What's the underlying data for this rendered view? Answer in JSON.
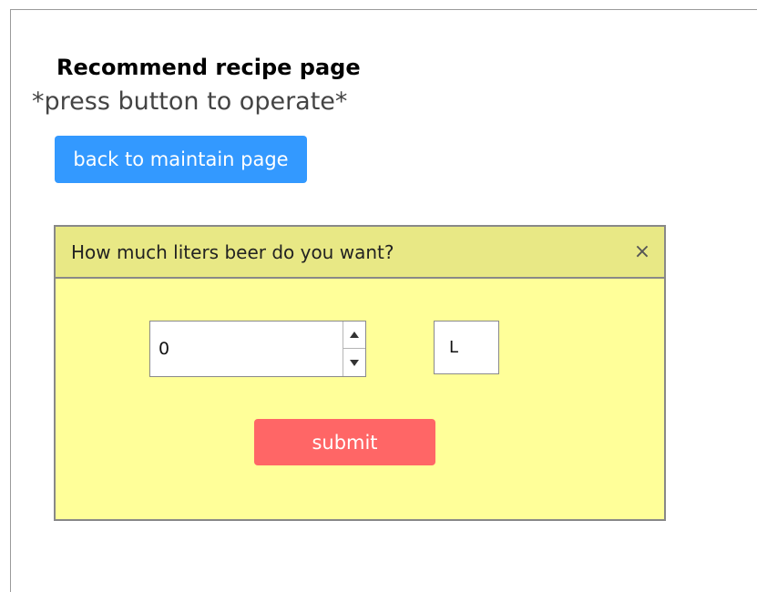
{
  "page": {
    "title": "Recommend recipe page",
    "subtitle": "*press button to operate*"
  },
  "actions": {
    "back_label": "back to maintain page"
  },
  "dialog": {
    "title": "How much liters beer do you want?",
    "close_label": "×",
    "liters_value": "0",
    "unit_label": "L",
    "submit_label": "submit"
  },
  "icons": {
    "close": "close-icon",
    "spin_up": "caret-up-icon",
    "spin_down": "caret-down-icon"
  },
  "colors": {
    "back_button": "#3399ff",
    "dialog_body": "#ffff99",
    "dialog_header": "#e8e885",
    "submit_button": "#ff6666"
  }
}
